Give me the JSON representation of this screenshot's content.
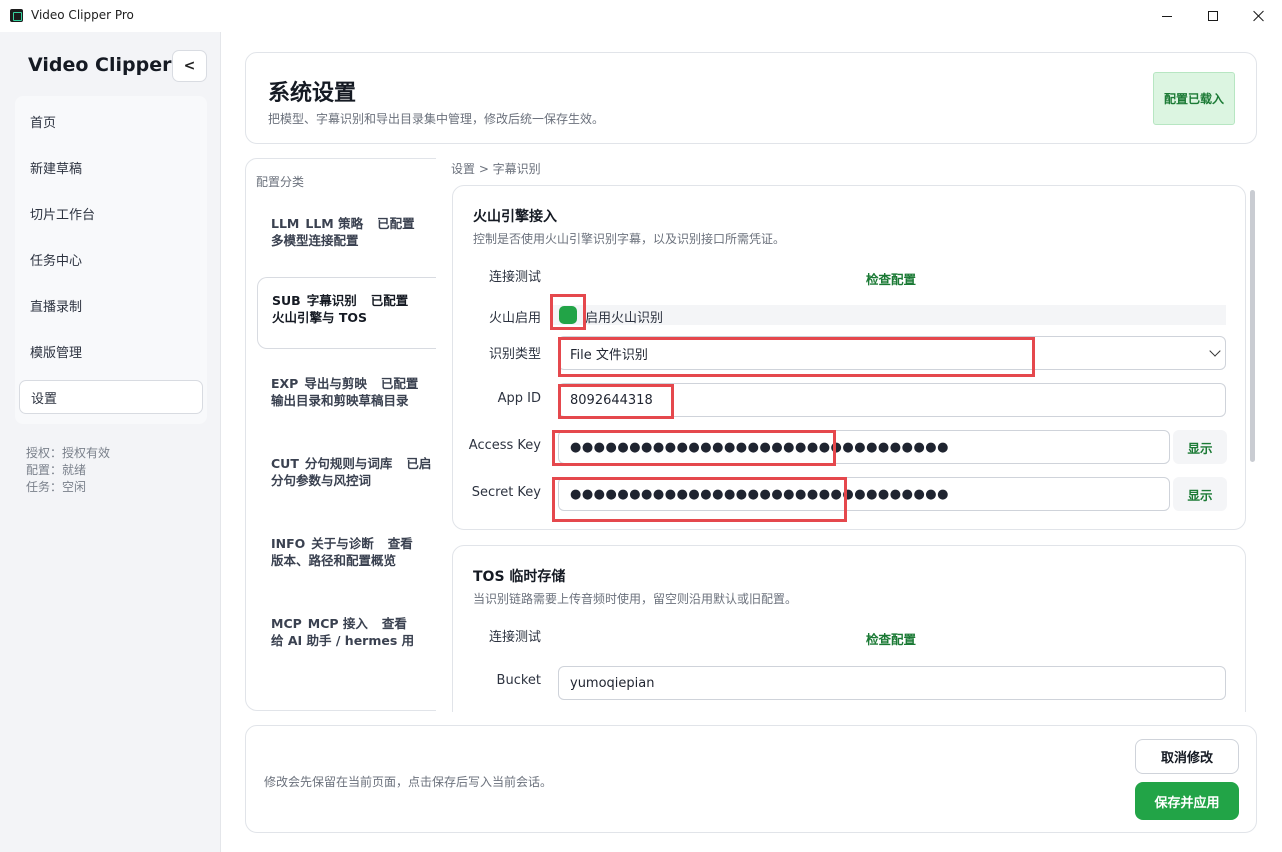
{
  "window": {
    "title": "Video Clipper Pro"
  },
  "sidebar": {
    "brand": "Video Clipper",
    "collapse_label": "<",
    "items": [
      {
        "label": "首页",
        "active": false
      },
      {
        "label": "新建草稿",
        "active": false
      },
      {
        "label": "切片工作台",
        "active": false
      },
      {
        "label": "任务中心",
        "active": false
      },
      {
        "label": "直播录制",
        "active": false
      },
      {
        "label": "模版管理",
        "active": false
      },
      {
        "label": "设置",
        "active": true
      }
    ],
    "status": [
      "授权：授权有效",
      "配置：就绪",
      "任务：空闲"
    ]
  },
  "header": {
    "title": "系统设置",
    "subtitle": "把模型、字幕识别和导出目录集中管理，修改后统一保存生效。",
    "badge": "配置已载入"
  },
  "categories": {
    "title": "配置分类",
    "items": [
      {
        "code": "LLM",
        "name": "LLM 策略",
        "state": "已配置",
        "desc": "多模型连接配置",
        "active": false
      },
      {
        "code": "SUB",
        "name": "字幕识别",
        "state": "已配置",
        "desc": "火山引擎与 TOS",
        "active": true
      },
      {
        "code": "EXP",
        "name": "导出与剪映",
        "state": "已配置",
        "desc": "输出目录和剪映草稿目录",
        "active": false
      },
      {
        "code": "CUT",
        "name": "分句规则与词库",
        "state": "已启",
        "desc": "分句参数与风控词",
        "active": false
      },
      {
        "code": "INFO",
        "name": "关于与诊断",
        "state": "查看",
        "desc": "版本、路径和配置概览",
        "active": false
      },
      {
        "code": "MCP",
        "name": "MCP 接入",
        "state": "查看",
        "desc": "给 AI 助手 / hermes 用",
        "active": false
      }
    ]
  },
  "breadcrumb": "设置 > 字幕识别",
  "volc": {
    "title": "火山引擎接入",
    "desc": "控制是否使用火山引擎识别字幕，以及识别接口所需凭证。",
    "test_label": "连接测试",
    "check_link": "检查配置",
    "enable_label": "火山启用",
    "enable_text": "启用火山识别",
    "enabled": true,
    "type_label": "识别类型",
    "type_value": "File 文件识别",
    "appid_label": "App ID",
    "appid_value": "8092644318",
    "access_label": "Access Key",
    "access_value": "●●●●●●●●●●●●●●●●●●●●●●●●●●●●●●●●",
    "secret_label": "Secret Key",
    "secret_value": "●●●●●●●●●●●●●●●●●●●●●●●●●●●●●●●●",
    "show_label": "显示"
  },
  "tos": {
    "title": "TOS 临时存储",
    "desc": "当识别链路需要上传音频时使用，留空则沿用默认或旧配置。",
    "test_label": "连接测试",
    "check_link": "检查配置",
    "bucket_label": "Bucket",
    "bucket_value": "yumoqiepian"
  },
  "footer": {
    "note": "修改会先保留在当前页面，点击保存后写入当前会话。",
    "cancel": "取消修改",
    "save": "保存并应用"
  },
  "colors": {
    "accent": "#22a447",
    "highlight": "#e5484d"
  }
}
